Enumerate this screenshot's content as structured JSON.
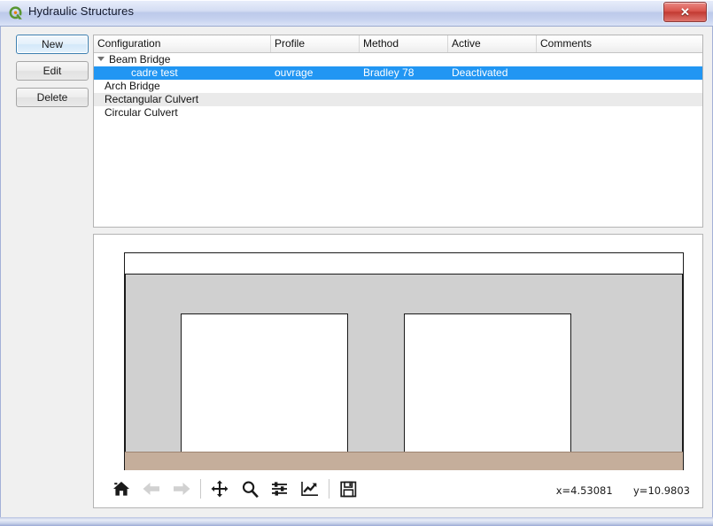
{
  "window": {
    "title": "Hydraulic Structures",
    "icon": "qgis-logo-icon",
    "close_label": "✕"
  },
  "buttons": {
    "new": "New",
    "edit": "Edit",
    "delete": "Delete"
  },
  "tree": {
    "columns": [
      "Configuration",
      "Profile",
      "Method",
      "Active",
      "Comments"
    ],
    "rows": [
      {
        "indent": 0,
        "expander": true,
        "selected": false,
        "alt": false,
        "cells": [
          "Beam Bridge",
          "",
          "",
          "",
          ""
        ]
      },
      {
        "indent": 1,
        "expander": false,
        "selected": true,
        "alt": false,
        "cells": [
          "cadre test",
          "ouvrage",
          "Bradley 78",
          "Deactivated",
          ""
        ]
      },
      {
        "indent": 0,
        "expander": false,
        "selected": false,
        "alt": false,
        "cells": [
          "Arch Bridge",
          "",
          "",
          "",
          ""
        ]
      },
      {
        "indent": 0,
        "expander": false,
        "selected": false,
        "alt": true,
        "cells": [
          "Rectangular Culvert",
          "",
          "",
          "",
          ""
        ]
      },
      {
        "indent": 0,
        "expander": false,
        "selected": false,
        "alt": false,
        "cells": [
          "Circular Culvert",
          "",
          "",
          "",
          ""
        ]
      }
    ]
  },
  "chart_data": {
    "type": "area",
    "title": "",
    "xlabel": "",
    "ylabel": "",
    "xlim": [
      0,
      10
    ],
    "ylim": [
      0,
      11
    ],
    "xticks": [
      0,
      2,
      4,
      6,
      8,
      10
    ],
    "yticks": [
      0,
      2,
      4,
      6,
      8,
      10
    ],
    "grid": false,
    "legend": false,
    "colors": {
      "deck": "#d0d0d0",
      "opening": "#ffffff",
      "bed": "#c5ae9b",
      "outline": "#1a1a1a"
    },
    "shapes": [
      {
        "name": "deck",
        "kind": "rect",
        "x0": 0,
        "x1": 10,
        "y0": 1,
        "y1": 10,
        "fill": "#d0d0d0"
      },
      {
        "name": "opening-left",
        "kind": "rect",
        "x0": 1,
        "x1": 4,
        "y0": 1,
        "y1": 8,
        "fill": "#ffffff"
      },
      {
        "name": "opening-right",
        "kind": "rect",
        "x0": 5,
        "x1": 8,
        "y0": 1,
        "y1": 8,
        "fill": "#ffffff"
      },
      {
        "name": "bed",
        "kind": "rect",
        "x0": 0,
        "x1": 10,
        "y0": 0,
        "y1": 1,
        "fill": "#c5ae9b"
      }
    ]
  },
  "toolbar": {
    "items": [
      {
        "name": "home-icon",
        "label": "Home",
        "disabled": false
      },
      {
        "name": "arrow-left-icon",
        "label": "Back",
        "disabled": true
      },
      {
        "name": "arrow-right-icon",
        "label": "Forward",
        "disabled": true
      },
      {
        "name": "pan-move-icon",
        "label": "Pan",
        "disabled": false
      },
      {
        "name": "magnifier-icon",
        "label": "Zoom",
        "disabled": false
      },
      {
        "name": "sliders-icon",
        "label": "Configure subplots",
        "disabled": false
      },
      {
        "name": "line-chart-icon",
        "label": "Edit axis/curve",
        "disabled": false
      },
      {
        "name": "floppy-save-icon",
        "label": "Save figure",
        "disabled": false
      }
    ]
  },
  "status": {
    "x_readout": "x=4.53081",
    "y_readout": "y=10.9803"
  }
}
